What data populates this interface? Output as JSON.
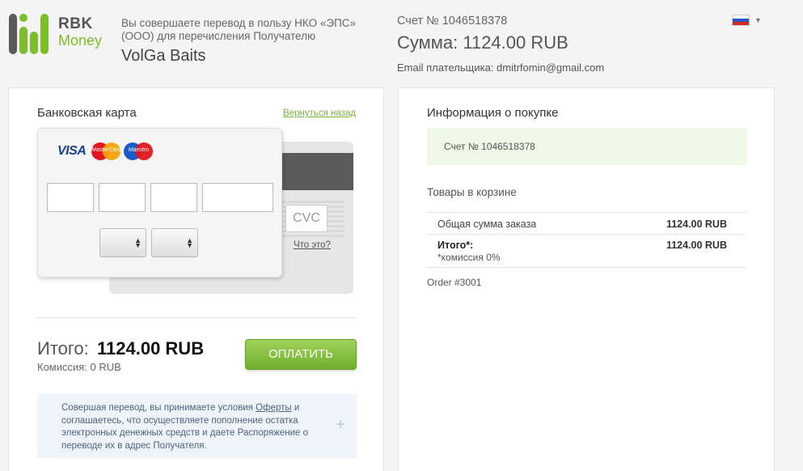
{
  "brand": {
    "line1": "RBK",
    "line2": "Money",
    "green": "#7cbd2b",
    "gray": "#5a5a5a"
  },
  "header": {
    "payee_description": "Вы совершаете перевод в пользу НКО «ЭПС» (ООО) для перечисления Получателю",
    "payee_name": "VolGa Baits",
    "invoice_number": "Счет № 1046518378",
    "amount": "Сумма: 1124.00 RUB",
    "email": "Email плательщика: dmitrfomin@gmail.com",
    "language": "ru-flag-icon"
  },
  "payment": {
    "title": "Банковская карта",
    "back_link": "Вернуться назад",
    "brands": {
      "visa": "VISA",
      "mastercard": "MasterCard",
      "maestro": "Maestro"
    },
    "cvc_placeholder": "CVC",
    "cvc_help": "Что это?",
    "total_label": "Итого:",
    "total_value": "1124.00 RUB",
    "commission": "Комиссия: 0 RUB",
    "pay_button": "ОПЛАТИТЬ",
    "terms": {
      "before": "Совершая перевод, вы принимаете условия ",
      "link": "Оферты",
      "after": " и соглашаетесь, что осуществляете пополнение остатка электронных денежных средств и даете Распоряжение о переводе их в адрес Получателя."
    }
  },
  "info": {
    "title": "Информация о покупке",
    "invoice": "Счет № 1046518378",
    "goods_title": "Товары в корзине",
    "rows": [
      {
        "label": "Общая сумма заказа",
        "value": "1124.00 RUB"
      },
      {
        "label": "Итого*:",
        "value": "1124.00 RUB",
        "note": "*комиссия 0%"
      }
    ],
    "order": "Order #3001"
  }
}
